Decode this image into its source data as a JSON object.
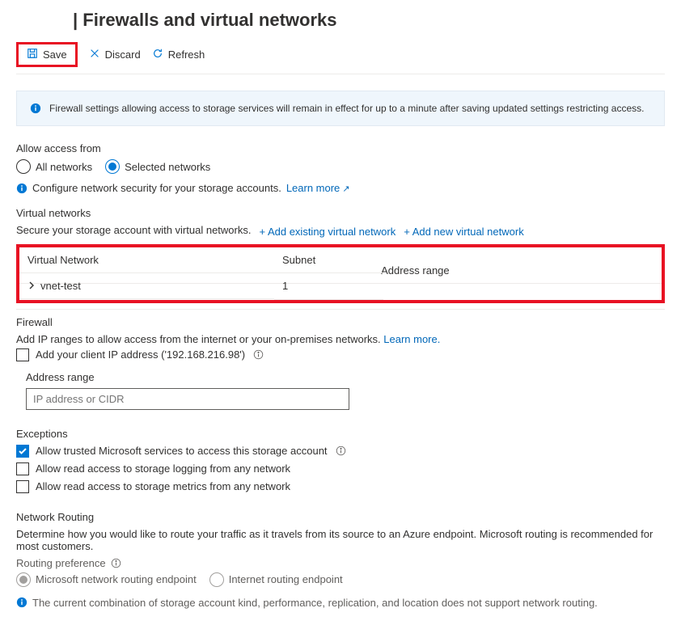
{
  "header": {
    "title": "| Firewalls and virtual networks"
  },
  "toolbar": {
    "save": "Save",
    "discard": "Discard",
    "refresh": "Refresh"
  },
  "banner": {
    "text": "Firewall settings allowing access to storage services will remain in effect for up to a minute after saving updated settings restricting access."
  },
  "access": {
    "label": "Allow access from",
    "all": "All networks",
    "selected": "Selected networks",
    "config_prefix": "Configure network security for your storage accounts.",
    "learn_more": "Learn more"
  },
  "vnet": {
    "heading": "Virtual networks",
    "desc": "Secure your storage account with virtual networks.",
    "add_existing": "+ Add existing virtual network",
    "add_new": "+ Add new virtual network",
    "cols": {
      "name": "Virtual Network",
      "subnet": "Subnet",
      "range": "Address range"
    },
    "rows": [
      {
        "name": "vnet-test",
        "subnet": "1",
        "range": ""
      }
    ]
  },
  "firewall": {
    "heading": "Firewall",
    "desc_pre": "Add IP ranges to allow access from the internet or your on-premises networks.",
    "learn_more": "Learn more.",
    "add_client_ip": "Add your client IP address ('192.168.216.98')",
    "range_label": "Address range",
    "range_placeholder": "IP address or CIDR"
  },
  "exceptions": {
    "heading": "Exceptions",
    "opt1": "Allow trusted Microsoft services to access this storage account",
    "opt2": "Allow read access to storage logging from any network",
    "opt3": "Allow read access to storage metrics from any network"
  },
  "routing": {
    "heading": "Network Routing",
    "desc": "Determine how you would like to route your traffic as it travels from its source to an Azure endpoint. Microsoft routing is recommended for most customers.",
    "pref_label": "Routing preference",
    "opt_ms": "Microsoft network routing endpoint",
    "opt_inet": "Internet routing endpoint",
    "warn": "The current combination of storage account kind, performance, replication, and location does not support network routing."
  }
}
